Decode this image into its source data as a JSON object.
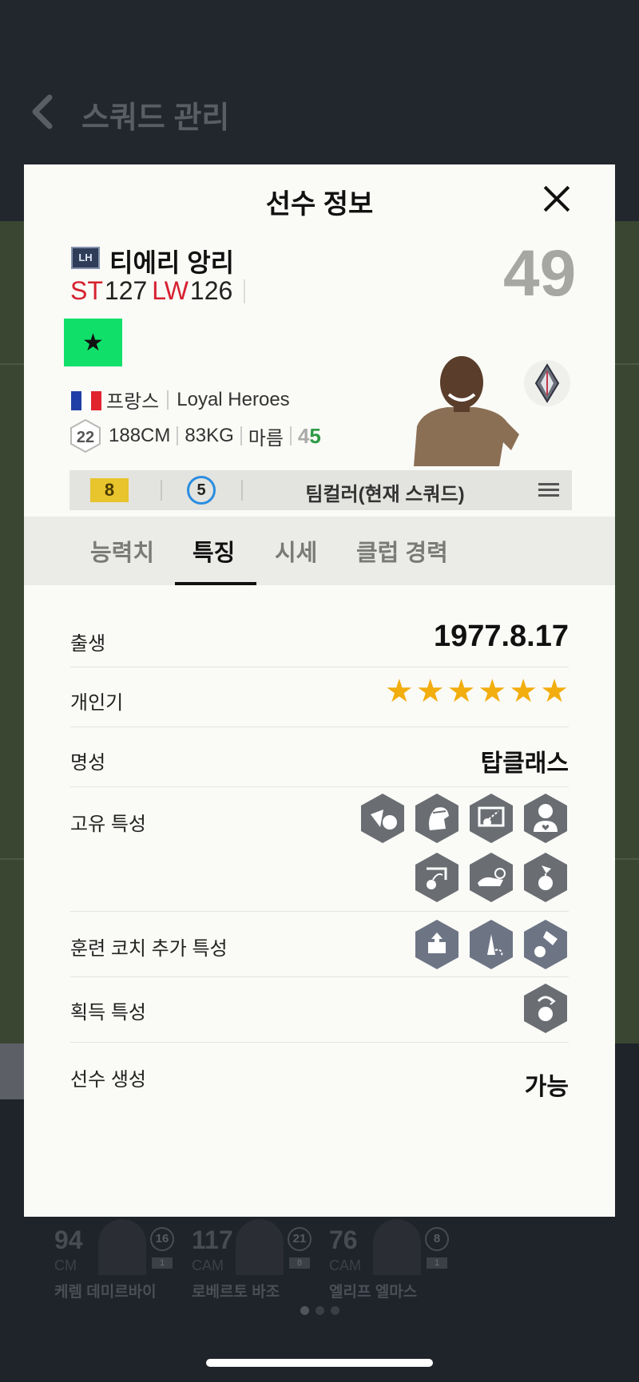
{
  "background": {
    "title": "스쿼드 관리",
    "cards": [
      {
        "ovr": "94",
        "pos": "CM",
        "num": "16",
        "badge": "1",
        "name": "케렘 데미르바이"
      },
      {
        "ovr": "117",
        "pos": "CAM",
        "num": "21",
        "badge": "8",
        "name": "로베르토 바조"
      },
      {
        "ovr": "76",
        "pos": "CAM",
        "num": "8",
        "badge": "1",
        "name": "엘리프 엘마스"
      }
    ]
  },
  "modal": {
    "title": "선수 정보",
    "player": {
      "season_badge": "LH",
      "name": "티에리 앙리",
      "positions": [
        {
          "code": "ST",
          "value": "127"
        },
        {
          "code": "LW",
          "value": "126"
        }
      ],
      "overall": "49",
      "trait_icon": "star-icon",
      "nation": "프랑스",
      "club": "Loyal Heroes",
      "age": "22",
      "height": "188CM",
      "weight": "83KG",
      "body_type": "마름",
      "weak_foot": "4",
      "strong_foot": "5",
      "grade": "8",
      "skill_moves": "5",
      "team_color": "팀컬러(현재 스쿼드)"
    },
    "tabs": [
      "능력치",
      "특징",
      "시세",
      "클럽 경력"
    ],
    "active_tab": 1,
    "details": {
      "birth_label": "출생",
      "birth_value": "1977.8.17",
      "popularity_label": "개인기",
      "popularity_stars": 6,
      "fame_label": "명성",
      "fame_value": "탑클래스",
      "unique_traits_label": "고유 특성",
      "unique_traits": [
        "finesse-shot-icon",
        "flair-icon",
        "long-shot-icon",
        "fan-favorite-icon",
        "chip-shot-icon",
        "speed-dribbler-icon",
        "tricky-dribbler-icon"
      ],
      "coach_traits_label": "훈련 코치 추가 특성",
      "coach_traits": [
        "early-crosser-icon",
        "dribbler-route-icon",
        "skill-kick-icon"
      ],
      "acquired_traits_label": "획득 특성",
      "acquired_traits": [
        "flair-pass-icon"
      ],
      "creation_label": "선수 생성",
      "creation_value": "가능"
    }
  },
  "colors": {
    "position_red": "#d72030",
    "trait_green": "#10e06a",
    "star_gold": "#f2ad0e",
    "grade_gold": "#e8c42d",
    "skill_blue": "#2a8de0"
  }
}
